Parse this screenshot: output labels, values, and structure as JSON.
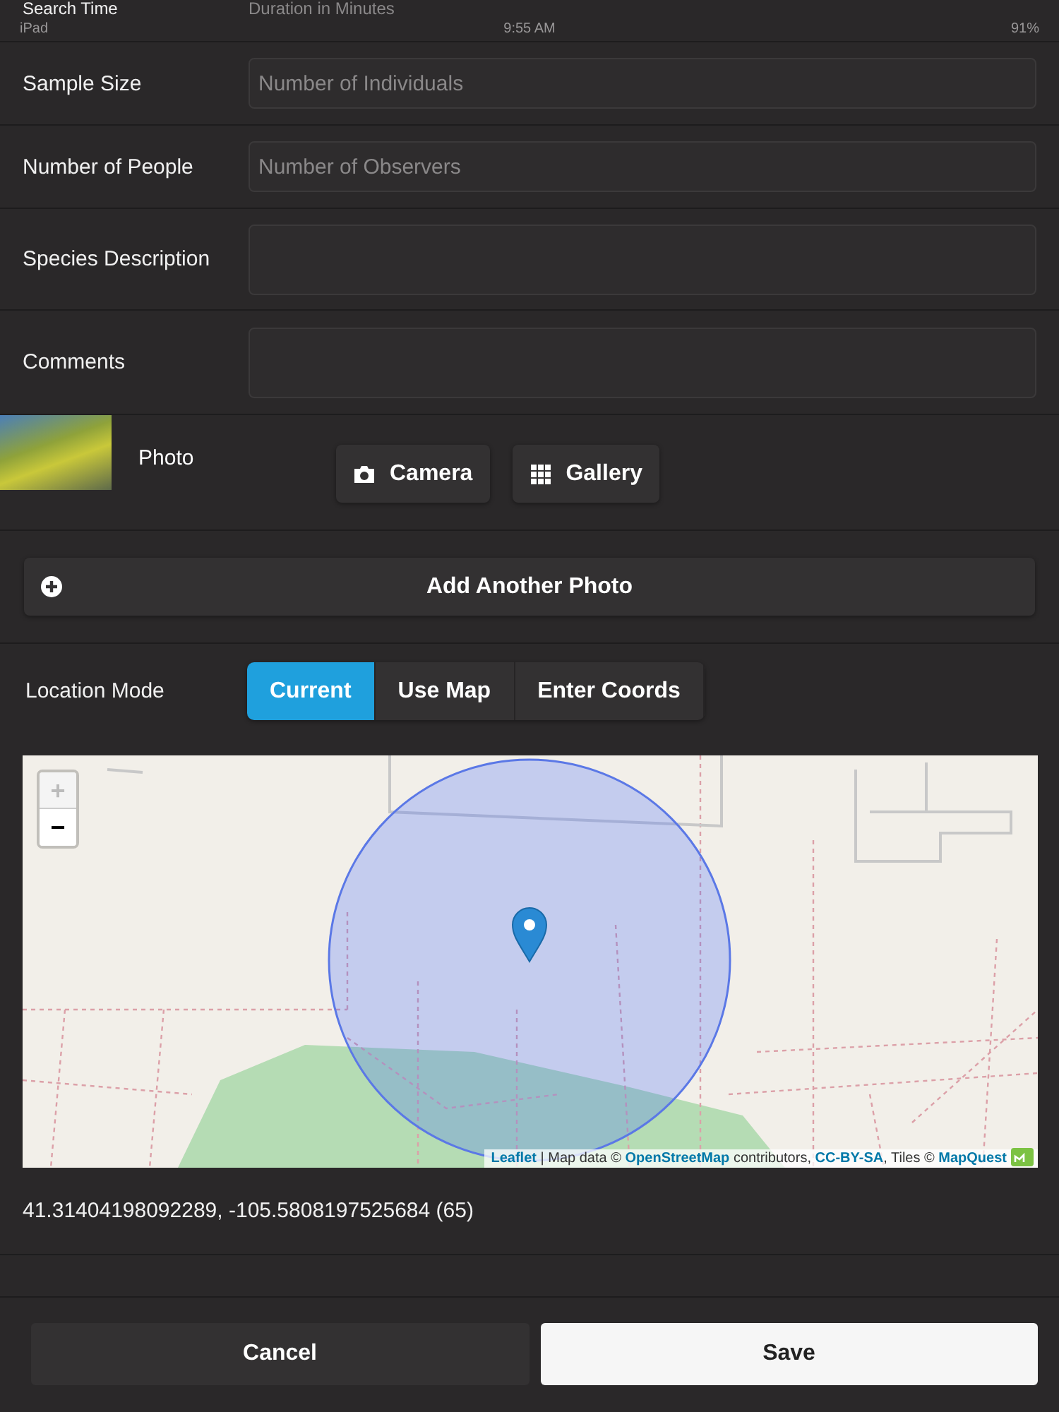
{
  "status_bar": {
    "device": "iPad",
    "time": "9:55 AM",
    "battery": "91%"
  },
  "fields": [
    {
      "label": "Search Time",
      "placeholder": "Duration in Minutes",
      "kind": "cut"
    },
    {
      "label": "Sample Size",
      "placeholder": "Number of Individuals",
      "kind": "input"
    },
    {
      "label": "Number of People",
      "placeholder": "Number of Observers",
      "kind": "input"
    },
    {
      "label": "Species Description",
      "kind": "textarea"
    },
    {
      "label": "Comments",
      "kind": "textarea"
    }
  ],
  "photo": {
    "label": "Photo",
    "buttons": [
      {
        "label": "Camera",
        "kind": "camera"
      },
      {
        "label": "Gallery",
        "kind": "grid"
      }
    ]
  },
  "add_photo_button": "Add Another Photo",
  "location_mode": {
    "label": "Location Mode",
    "options": [
      {
        "label": "Current",
        "selected": true
      },
      {
        "label": "Use Map",
        "selected": false
      },
      {
        "label": "Enter Coords",
        "selected": false
      }
    ]
  },
  "map": {
    "zoom_in": "+",
    "zoom_out": "−",
    "attribution": [
      {
        "kind": "link",
        "text": "Leaflet"
      },
      {
        "kind": "text",
        "text": " | Map data © "
      },
      {
        "kind": "link",
        "text": "OpenStreetMap"
      },
      {
        "kind": "text",
        "text": " contributors, "
      },
      {
        "kind": "link",
        "text": "CC-BY-SA"
      },
      {
        "kind": "text",
        "text": ", Tiles © "
      },
      {
        "kind": "link",
        "text": "MapQuest"
      }
    ]
  },
  "coordinates": "41.31404198092289, -105.5808197525684 (65)",
  "actions": [
    {
      "label": "Cancel",
      "kind": "secondary"
    },
    {
      "label": "Save",
      "kind": "primary"
    }
  ]
}
